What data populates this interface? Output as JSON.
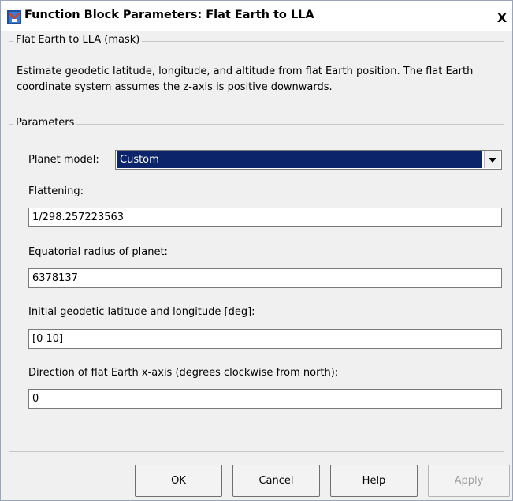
{
  "window": {
    "title": "Function Block Parameters: Flat Earth to LLA",
    "close_glyph": "X"
  },
  "mask": {
    "legend": "Flat Earth to LLA (mask)",
    "description": "Estimate geodetic latitude, longitude, and altitude from flat Earth position.  The flat Earth coordinate system assumes the z-axis is positive downwards."
  },
  "params": {
    "legend": "Parameters",
    "planet_model_label": "Planet model:",
    "planet_model_value": "Custom",
    "flattening_label": "Flattening:",
    "flattening_value": "1/298.257223563",
    "radius_label": "Equatorial radius of planet:",
    "radius_value": "6378137",
    "latlon_label": "Initial geodetic latitude and longitude [deg]:",
    "latlon_value": "[0 10]",
    "direction_label": "Direction of flat Earth x-axis (degrees clockwise from north):",
    "direction_value": "0"
  },
  "buttons": {
    "ok": "OK",
    "cancel": "Cancel",
    "help": "Help",
    "apply": "Apply"
  }
}
